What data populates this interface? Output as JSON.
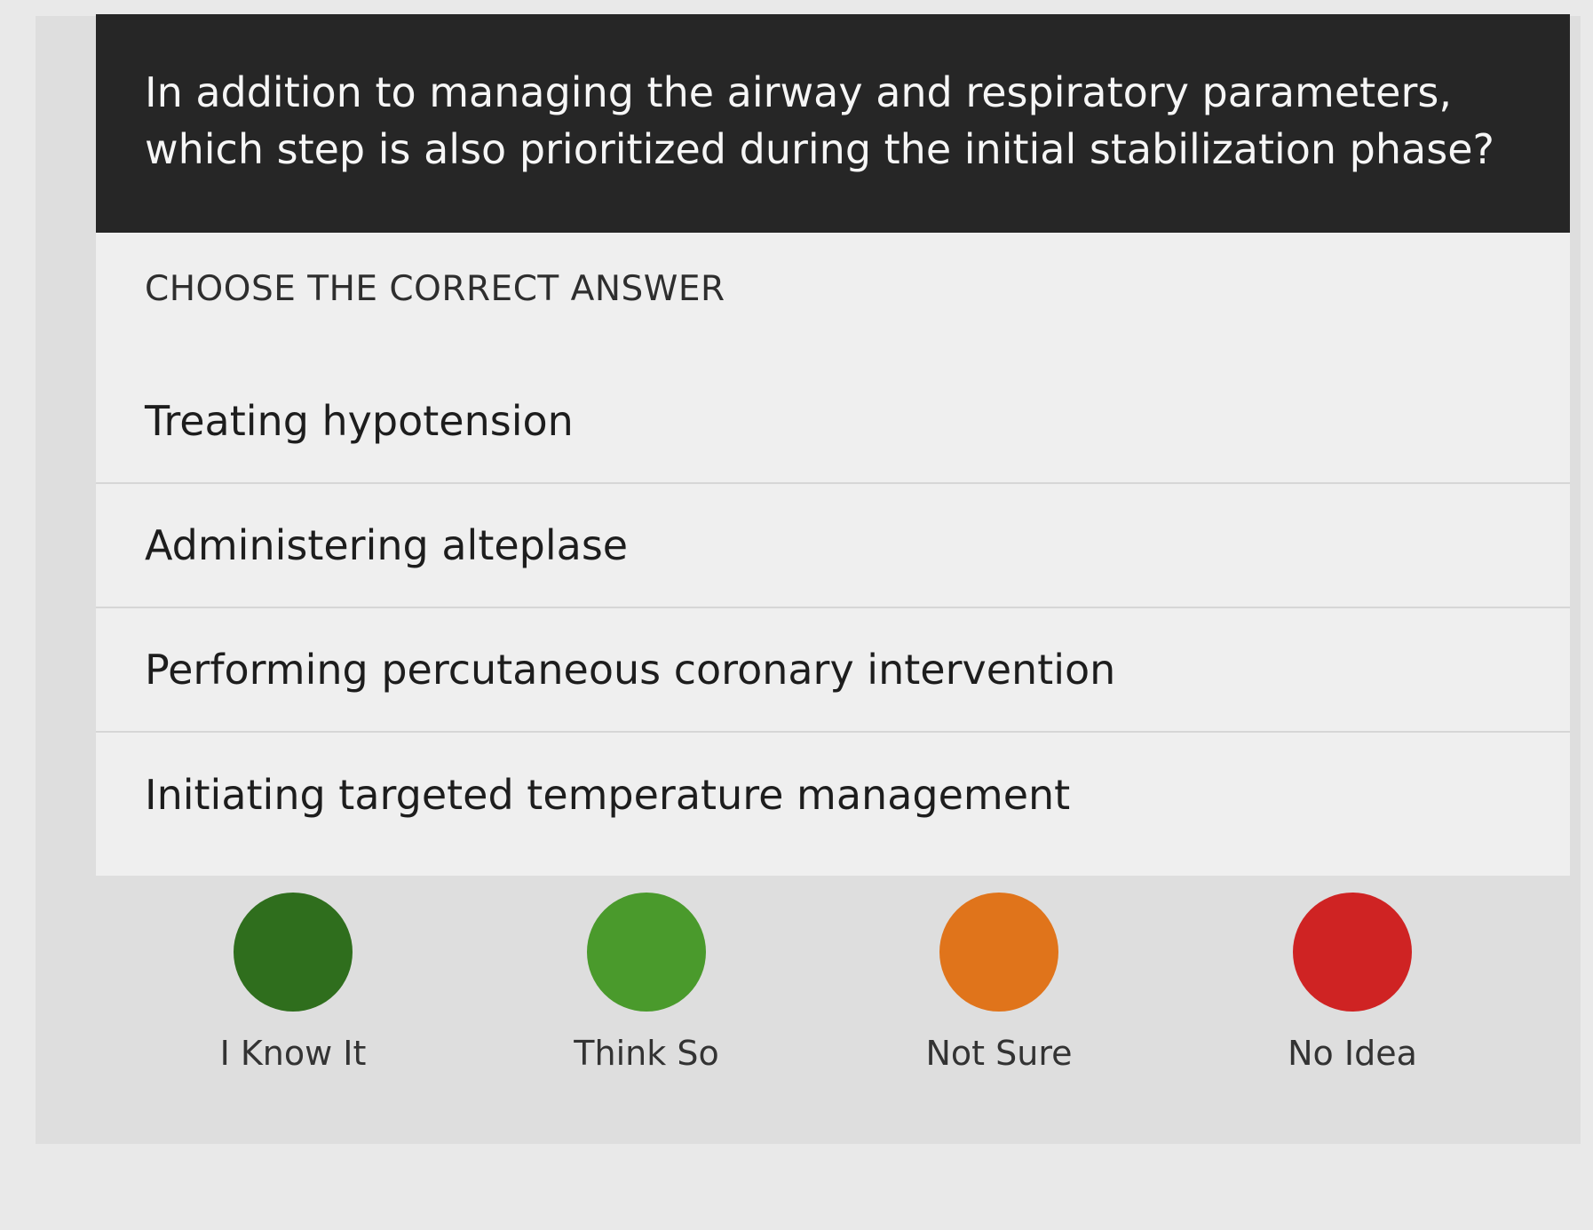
{
  "question": {
    "text": "In addition to managing the airway and respiratory parameters, which step is also prioritized during the initial stabilization phase?"
  },
  "instruction": "CHOOSE THE CORRECT ANSWER",
  "answers": [
    {
      "label": "Treating hypotension"
    },
    {
      "label": "Administering alteplase"
    },
    {
      "label": "Performing percutaneous coronary intervention"
    },
    {
      "label": "Initiating targeted temperature management"
    }
  ],
  "confidence": [
    {
      "label": "I Know It",
      "color": "#2f6e1d"
    },
    {
      "label": "Think So",
      "color": "#4a9a2c"
    },
    {
      "label": "Not Sure",
      "color": "#e0741b"
    },
    {
      "label": "No Idea",
      "color": "#cf2323"
    }
  ]
}
